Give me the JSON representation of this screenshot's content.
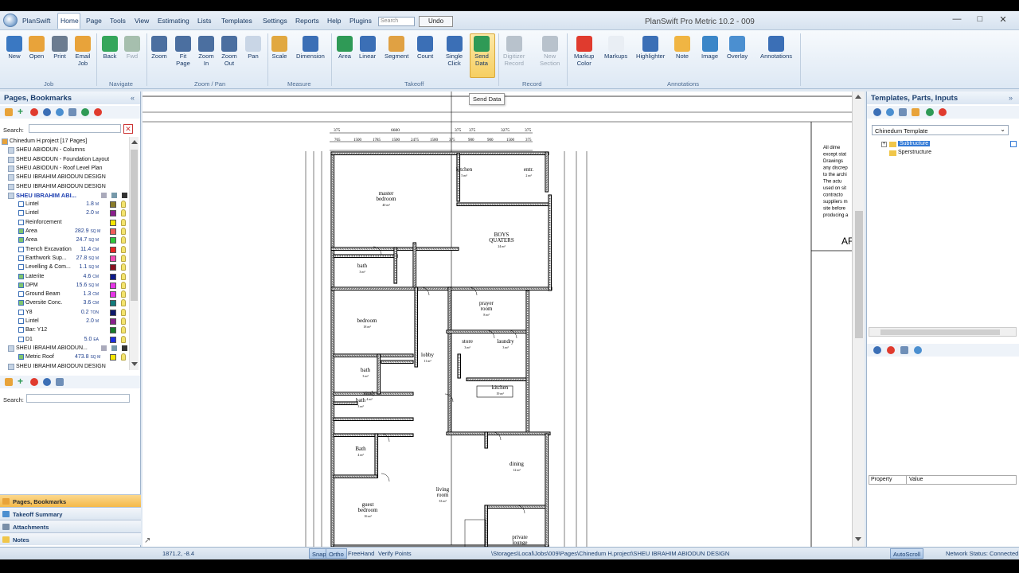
{
  "app": {
    "name": "PlanSwift",
    "window_title": "PlanSwift Pro Metric 10.2 - 009",
    "menu": [
      "Home",
      "Page",
      "Tools",
      "View",
      "Estimating",
      "Lists",
      "Templates",
      "Settings",
      "Reports",
      "Help",
      "Plugins"
    ],
    "search_placeholder": "Search",
    "undo_label": "Undo"
  },
  "ribbon": {
    "buttons": [
      {
        "label": "New",
        "color": "#3a78c2"
      },
      {
        "label": "Open",
        "color": "#e8a33a"
      },
      {
        "label": "Print",
        "color": "#6b7c90"
      },
      {
        "label": "Email\nJob",
        "color": "#e8a33a"
      },
      {
        "label": "Back",
        "color": "#35a65b"
      },
      {
        "label": "Fwd",
        "color": "#a6bfae",
        "disabled": true
      },
      {
        "label": "Zoom",
        "color": "#4b6fa0"
      },
      {
        "label": "Fit\nPage",
        "color": "#4b6fa0"
      },
      {
        "label": "Zoom\nIn",
        "color": "#4b6fa0"
      },
      {
        "label": "Zoom\nOut",
        "color": "#4b6fa0"
      },
      {
        "label": "Pan",
        "color": "#c9d6e6"
      },
      {
        "label": "Scale",
        "color": "#e1a840"
      },
      {
        "label": "Dimension",
        "color": "#3b6fb6"
      },
      {
        "label": "Area",
        "color": "#2f9a56"
      },
      {
        "label": "Linear",
        "color": "#3b6fb6"
      },
      {
        "label": "Segment",
        "color": "#e0a143"
      },
      {
        "label": "Count",
        "color": "#3b6fb6"
      },
      {
        "label": "Single\nClick",
        "color": "#3b6fb6"
      },
      {
        "label": "Send\nData",
        "color": "#2f9a56"
      },
      {
        "label": "Digitizer\nRecord",
        "color": "#b8c2cc",
        "disabled": true
      },
      {
        "label": "New\nSection",
        "color": "#b8c2cc",
        "disabled": true
      },
      {
        "label": "Markup\nColor",
        "color": "#e03b2e"
      },
      {
        "label": "Markups",
        "color": "#e9eef4"
      },
      {
        "label": "Highlighter",
        "color": "#3b6fb6"
      },
      {
        "label": "Note",
        "color": "#f0b543"
      },
      {
        "label": "Image",
        "color": "#3b86c8"
      },
      {
        "label": "Overlay",
        "color": "#4b8fd0"
      },
      {
        "label": "Annotations",
        "color": "#3b6fb6"
      }
    ],
    "groups": [
      "Job",
      "Navigate",
      "Zoom / Pan",
      "Measure",
      "Takeoff",
      "Record",
      "Annotations"
    ],
    "tooltip": "Send Data"
  },
  "left_panel": {
    "title": "Pages, Bookmarks",
    "search_label": "Search:",
    "tree": [
      {
        "text": "Chinedum H.project [17 Pages]",
        "level": 0,
        "type": "project"
      },
      {
        "text": "SHEU ABIODUN - Columns",
        "level": 1,
        "type": "page"
      },
      {
        "text": "SHEU ABIODUN - Foundation Layout",
        "level": 1,
        "type": "page"
      },
      {
        "text": "SHEU ABIODUN - Roof Level Plan",
        "level": 1,
        "type": "page"
      },
      {
        "text": "SHEU IBRAHIM ABIODUN DESIGN",
        "level": 1,
        "type": "page"
      },
      {
        "text": "SHEU IBRAHIM ABIODUN DESIGN",
        "level": 1,
        "type": "page"
      },
      {
        "text": "SHEU IBRAHIM ABI...",
        "level": 1,
        "type": "page-active"
      },
      {
        "text": "Lintel",
        "level": 2,
        "value": "1.8",
        "unit": "M",
        "color": "#8a7c2b"
      },
      {
        "text": "Lintel",
        "level": 2,
        "value": "2.0",
        "unit": "M",
        "color": "#8a1f8c"
      },
      {
        "text": "Reinforcement",
        "level": 2,
        "value": "",
        "unit": "",
        "color": "#f5e600"
      },
      {
        "text": "Area",
        "level": 2,
        "value": "282.9",
        "unit": "SQ M",
        "color": "#f05a5a"
      },
      {
        "text": "Area",
        "level": 2,
        "value": "24.7",
        "unit": "SQ M",
        "color": "#2ec63b"
      },
      {
        "text": "Trench Excavation",
        "level": 2,
        "value": "11.4",
        "unit": "CM",
        "color": "#e82323"
      },
      {
        "text": "Earthwork Sup...",
        "level": 2,
        "value": "27.8",
        "unit": "SQ M",
        "color": "#f34ab6"
      },
      {
        "text": "Levelling & Com...",
        "level": 2,
        "value": "1.1",
        "unit": "SQ M",
        "color": "#8a1020"
      },
      {
        "text": "Laterite",
        "level": 2,
        "value": "4.6",
        "unit": "CM",
        "color": "#0d1a8a"
      },
      {
        "text": "DPM",
        "level": 2,
        "value": "15.6",
        "unit": "SQ M",
        "color": "#e635e6"
      },
      {
        "text": "Ground Beam",
        "level": 2,
        "value": "1.3",
        "unit": "CM",
        "color": "#e635e6"
      },
      {
        "text": "Oversite Conc.",
        "level": 2,
        "value": "3.6",
        "unit": "CM",
        "color": "#127b7b"
      },
      {
        "text": "Y8",
        "level": 2,
        "value": "0.2",
        "unit": "TON",
        "color": "#0d1a6b"
      },
      {
        "text": "Lintel",
        "level": 2,
        "value": "2.0",
        "unit": "M",
        "color": "#8a1f8c"
      },
      {
        "text": "Bar: Y12",
        "level": 2,
        "value": "",
        "unit": "",
        "color": "#167a2a"
      },
      {
        "text": "D1",
        "level": 2,
        "value": "5.0",
        "unit": "EA",
        "color": "#1c2fe0"
      },
      {
        "text": "SHEU IBRAHIM ABIODUN...",
        "level": 1,
        "type": "page"
      },
      {
        "text": "Metric Roof",
        "level": 2,
        "value": "473.8",
        "unit": "SQ M",
        "color": "#f5e600"
      },
      {
        "text": "SHEU IBRAHIM ABIODUN DESIGN",
        "level": 1,
        "type": "page"
      }
    ],
    "search2_label": "Search:",
    "accordion": [
      "Pages, Bookmarks",
      "Takeoff Summary",
      "Attachments",
      "Notes"
    ]
  },
  "right_panel": {
    "title": "Templates, Parts, Inputs",
    "template_select": "Chinedum Template",
    "tree": [
      "Subtructure",
      "Sperstructure"
    ],
    "prop_headers": [
      "Property",
      "Value"
    ]
  },
  "status": {
    "coords": "1871.2, -8.4",
    "buttons": [
      "Snap",
      "Ortho",
      "FreeHand",
      "Verify Points"
    ],
    "path": "\\Storages\\Local\\Jobs\\009\\Pages\\Chinedum H.project\\SHEU IBRAHIM ABIODUN DESIGN",
    "autoscroll": "AutoScroll",
    "network": "Network Status: Connected"
  },
  "drawing": {
    "rooms": [
      {
        "name": "master\nbedroom",
        "area": "40 m²"
      },
      {
        "name": "bath",
        "area": "3 m²"
      },
      {
        "name": "kitchen",
        "area": "5 m²"
      },
      {
        "name": "entr.",
        "area": "2 m²"
      },
      {
        "name": "BOYS\nQUATERS",
        "area": "24 m²"
      },
      {
        "name": "bath",
        "area": "3 m²"
      },
      {
        "name": "bedroom",
        "area": "18 m²"
      },
      {
        "name": "prayer\nroom",
        "area": "8 m²"
      },
      {
        "name": "store",
        "area": "3 m²"
      },
      {
        "name": "laundry",
        "area": "3 m²"
      },
      {
        "name": "bath",
        "area": "3 m²"
      },
      {
        "name": "lobby",
        "area": "11 m²"
      },
      {
        "name": "kitchen",
        "area": "19 m²"
      },
      {
        "name": "study",
        "area": "4 m²"
      },
      {
        "name": "Bath",
        "area": "4 m²"
      },
      {
        "name": "dining",
        "area": "12 m²"
      },
      {
        "name": "living\nroom",
        "area": "33 m²"
      },
      {
        "name": "guest\nbedroom",
        "area": "16 m²"
      },
      {
        "name": "private\nlounge",
        "area": ""
      }
    ],
    "dims_top": [
      "375",
      "6600",
      "375",
      "375",
      "3275",
      "375"
    ],
    "dims_top2": [
      "765",
      "1500",
      "1785",
      "1500",
      "2475",
      "1500",
      "375",
      "900",
      "900",
      "1500",
      "375"
    ],
    "notes": [
      "All dime",
      "except stat",
      "Drawings",
      "any discrep",
      "to the archi",
      "The actu",
      "used on sit",
      "contracto",
      "suppliers m",
      "site before",
      "producing a"
    ],
    "title_snippet": "AF"
  }
}
